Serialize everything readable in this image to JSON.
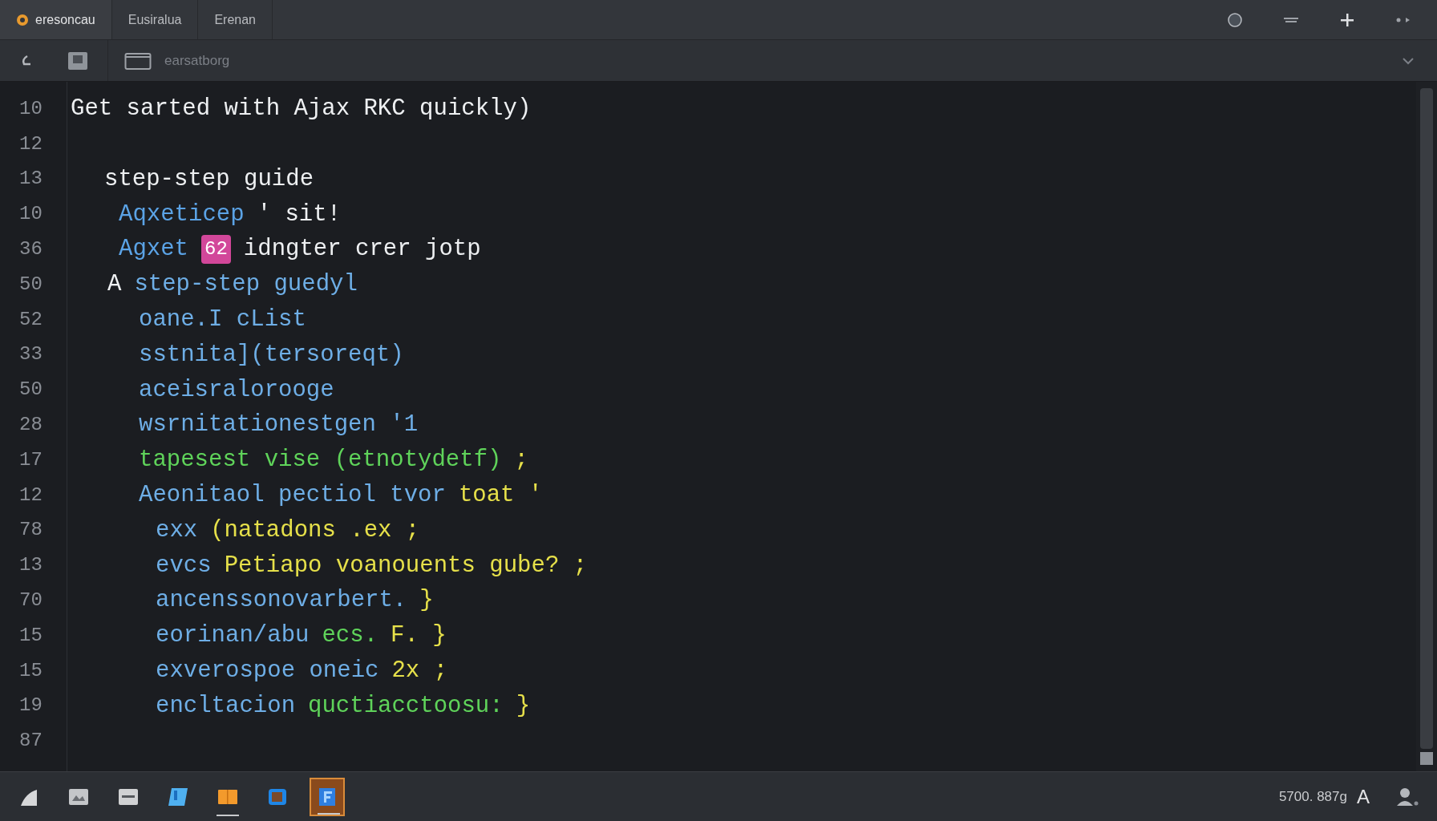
{
  "tabs": [
    {
      "label": "eresoncau",
      "selected": true
    },
    {
      "label": "Eusiralua",
      "selected": false
    },
    {
      "label": "Erenan",
      "selected": false
    }
  ],
  "toolbar": {
    "path": "earsatborg"
  },
  "editor": {
    "lines": [
      {
        "number": "10",
        "kind": "title",
        "segments": [
          {
            "text": "Get sarted with Ajax RKC quickly)",
            "color": "#eef0f2"
          }
        ]
      },
      {
        "number": "12",
        "kind": "title"
      },
      {
        "number": "13",
        "kind": "heading",
        "segments": [
          {
            "text": "step-step guide",
            "color": "#eef0f2"
          }
        ]
      },
      {
        "number": "10",
        "kind": "note",
        "segments": [
          {
            "text": "Aqxeticep",
            "color": "#5ba3e6"
          },
          {
            "text": "' sit!",
            "color": "#eef0f2"
          }
        ]
      },
      {
        "number": "36",
        "kind": "note",
        "segments": [
          {
            "text": "Agxet",
            "color": "#5ba3e6"
          },
          {
            "text": "62",
            "color": "#d2479a",
            "kind": "badge"
          },
          {
            "text": "idngter crer jotp",
            "color": "#eef0f2"
          }
        ]
      },
      {
        "number": "50",
        "kind": "outline",
        "segments": [
          {
            "text": "A",
            "color": "#eef0f2"
          },
          {
            "text": "step-step guedyl",
            "color": "#6eaee6"
          }
        ]
      },
      {
        "number": "52",
        "kind": "entry",
        "segments": [
          {
            "text": "oane.I cList",
            "color": "#6eaee6"
          }
        ]
      },
      {
        "number": "33",
        "kind": "entry",
        "segments": [
          {
            "text": "sstnita](tersoreqt)",
            "color": "#6eaee6"
          }
        ]
      },
      {
        "number": "50",
        "kind": "entry",
        "segments": [
          {
            "text": "aceisralorooge",
            "color": "#6eaee6"
          }
        ]
      },
      {
        "number": "28",
        "kind": "entry",
        "segments": [
          {
            "text": "wsrnitationestgen '1",
            "color": "#6eaee6"
          }
        ]
      },
      {
        "number": "17",
        "kind": "entry",
        "segments": [
          {
            "text": "tapesest vise (etnotydetf)",
            "color": "#5fd35a"
          },
          {
            "text": ";",
            "color": "#e6e04a"
          }
        ]
      },
      {
        "number": "12",
        "kind": "entry",
        "segments": [
          {
            "text": "Aeonitaol pectiol tvor",
            "color": "#6eaee6"
          },
          {
            "text": "toat '",
            "color": "#e6e04a"
          }
        ]
      },
      {
        "number": "78",
        "kind": "detail",
        "segments": [
          {
            "text": "exx",
            "color": "#6eaee6"
          },
          {
            "text": "(natadons .ex ;",
            "color": "#e6e04a"
          }
        ]
      },
      {
        "number": "13",
        "kind": "detail",
        "segments": [
          {
            "text": "evcs",
            "color": "#6eaee6"
          },
          {
            "text": "Petiapo voanouents gube? ;",
            "color": "#e6e04a"
          }
        ]
      },
      {
        "number": "70",
        "kind": "detail",
        "segments": [
          {
            "text": "ancenssonovarbert.",
            "color": "#6eaee6"
          },
          {
            "text": "}",
            "color": "#e6e04a"
          }
        ]
      },
      {
        "number": "15",
        "kind": "detail",
        "segments": [
          {
            "text": "eorinan/abu",
            "color": "#6eaee6"
          },
          {
            "text": "ecs.",
            "color": "#5fd35a"
          },
          {
            "text": "F. }",
            "color": "#e6e04a"
          }
        ]
      },
      {
        "number": "15",
        "kind": "detail",
        "segments": [
          {
            "text": "exverospoe oneic",
            "color": "#6eaee6"
          },
          {
            "text": "2x ;",
            "color": "#e6e04a"
          }
        ]
      },
      {
        "number": "19",
        "kind": "detail",
        "segments": [
          {
            "text": "encltacion",
            "color": "#6eaee6"
          },
          {
            "text": "quctiacctoosu:",
            "color": "#5fd35a"
          },
          {
            "text": "}",
            "color": "#e6e04a"
          }
        ]
      },
      {
        "number": "87",
        "kind": "title"
      }
    ]
  },
  "taskbar": {
    "apps": [
      {
        "kind": "shape",
        "selected": false,
        "running": false
      },
      {
        "kind": "image",
        "selected": false,
        "running": false
      },
      {
        "kind": "window",
        "selected": false,
        "running": false
      },
      {
        "kind": "document",
        "selected": false,
        "running": false
      },
      {
        "kind": "folder",
        "selected": false,
        "running": true
      },
      {
        "kind": "square",
        "selected": false,
        "running": false
      },
      {
        "kind": "editor",
        "selected": true,
        "running": true
      }
    ],
    "status": "5700. 887g",
    "input_indicator": "A"
  }
}
